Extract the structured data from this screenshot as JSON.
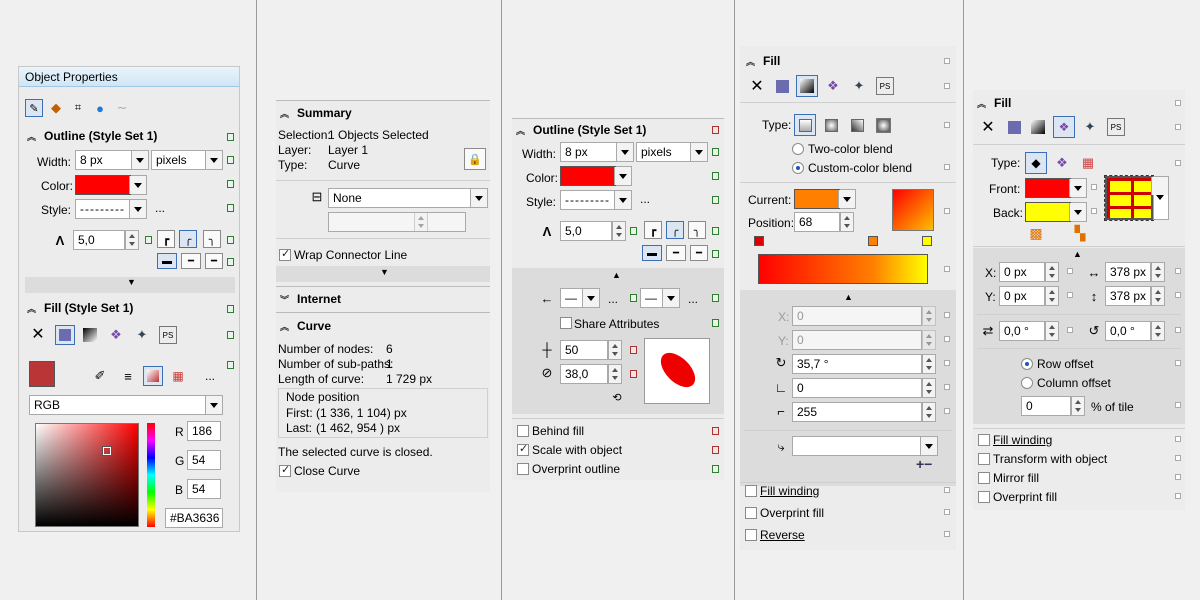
{
  "p1": {
    "title": "Object Properties",
    "outline_title": "Outline (Style Set 1)",
    "width_label": "Width:",
    "width_value": "8 px",
    "units": "pixels",
    "color_label": "Color:",
    "style_label": "Style:",
    "miter_value": "5,0",
    "fill_title": "Fill (Style Set 1)",
    "model": "RGB",
    "r_label": "R",
    "r": "186",
    "g_label": "G",
    "g": "54",
    "b_label": "B",
    "b": "54",
    "hex": "#BA3636",
    "more": "...",
    "fill_color": "#ba3636",
    "outline_color": "#ff0000"
  },
  "p2": {
    "summary_title": "Summary",
    "selection_label": "Selection:",
    "selection_value": "1 Objects Selected",
    "layer_label": "Layer:",
    "layer_value": "Layer 1",
    "type_label": "Type:",
    "type_value": "Curve",
    "connector": "None",
    "wrap_label": "Wrap Connector Line",
    "internet_title": "Internet",
    "curve_title": "Curve",
    "nodes_label": "Number of nodes:",
    "nodes_value": "6",
    "subpaths_label": "Number of sub-paths:",
    "subpaths_value": "1",
    "length_label": "Length of curve:",
    "length_value": "1 729 px",
    "node_pos_label": "Node position",
    "first_label": "First:",
    "first_value": "(1 336, 1 104) px",
    "last_label": "Last:",
    "last_value": "(1 462, 954 ) px",
    "closed_text": "The selected curve is closed.",
    "close_label": "Close Curve"
  },
  "p3": {
    "title": "Outline (Style Set 1)",
    "width_label": "Width:",
    "width_value": "8 px",
    "units": "pixels",
    "color_label": "Color:",
    "style_label": "Style:",
    "miter": "5,0",
    "share_label": "Share Attributes",
    "stretch": "50",
    "angle": "38,0",
    "behind_label": "Behind fill",
    "scale_label": "Scale with object",
    "overprint_label": "Overprint outline",
    "more": "..."
  },
  "p4": {
    "title": "Fill",
    "type_label": "Type:",
    "two_color": "Two-color blend",
    "custom_color": "Custom-color blend",
    "current_label": "Current:",
    "position_label": "Position:",
    "position_value": "68",
    "x_label": "X:",
    "x_value": "0",
    "y_label": "Y:",
    "y_value": "0",
    "angle_value": "35,7 °",
    "skew_value": "0",
    "steps_value": "255",
    "fill_winding": "Fill winding",
    "overprint": "Overprint fill",
    "reverse": "Reverse",
    "plus_minus": "+−"
  },
  "p5": {
    "title": "Fill",
    "type_label": "Type:",
    "front_label": "Front:",
    "back_label": "Back:",
    "x_label": "X:",
    "x_value": "0 px",
    "y_label": "Y:",
    "y_value": "0 px",
    "w_value": "378 px",
    "h_value": "378 px",
    "rot_value": "0,0 °",
    "skew_value": "0,0 °",
    "row_offset": "Row offset",
    "col_offset": "Column offset",
    "offset_value": "0",
    "pct_label": "% of tile",
    "fill_winding": "Fill winding",
    "transform": "Transform with object",
    "mirror": "Mirror fill",
    "overprint": "Overprint fill"
  }
}
